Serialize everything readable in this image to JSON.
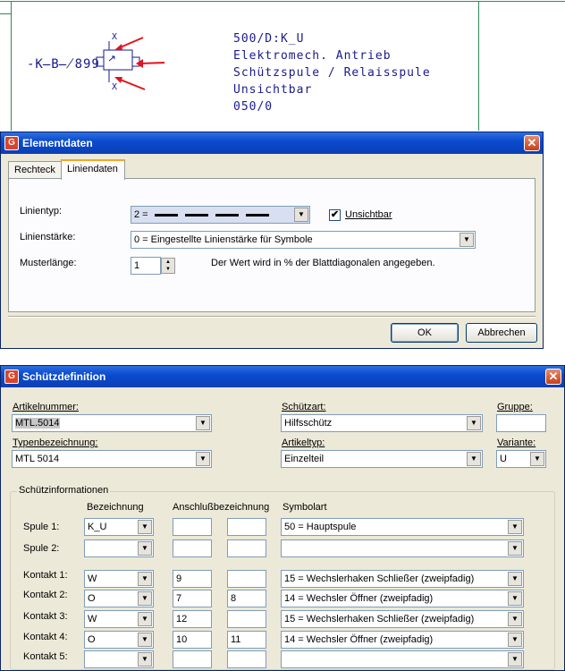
{
  "cad": {
    "designation": "-K̶B̶̸899",
    "info_lines": [
      "500/D:K_U",
      "Elektromech. Antrieb",
      "Schützspule / Relaisspule",
      "Unsichtbar",
      "050/0"
    ],
    "symbol_label": "X"
  },
  "elementdaten": {
    "title": "Elementdaten",
    "tabs": [
      "Rechteck",
      "Liniendaten"
    ],
    "linientyp_label": "Linientyp:",
    "linientyp_value": "2 =",
    "unsichtbar_label": "Unsichtbar",
    "unsichtbar_checked": "✔",
    "linienstaerke_label": "Linienstärke:",
    "linienstaerke_value": "0 = Eingestellte Linienstärke für Symbole",
    "musterlaenge_label": "Musterlänge:",
    "musterlaenge_value": "1",
    "musterlaenge_hint": "Der Wert wird in % der Blattdiagonalen angegeben.",
    "ok_label": "OK",
    "cancel_label": "Abbrechen"
  },
  "schuetz": {
    "title": "Schützdefinition",
    "artikelnummer_label": "Artikelnummer:",
    "artikelnummer_value": "MTL.5014",
    "schuetzart_label": "Schützart:",
    "schuetzart_value": "Hilfsschütz",
    "gruppe_label": "Gruppe:",
    "gruppe_value": "",
    "typenbezeichnung_label": "Typenbezeichnung:",
    "typenbezeichnung_value": "MTL 5014",
    "artikeltyp_label": "Artikeltyp:",
    "artikeltyp_value": "Einzelteil",
    "variante_label": "Variante:",
    "variante_value": "U",
    "group_label": "Schützinformationen",
    "col_bezeichnung": "Bezeichnung",
    "col_anschluss": "Anschlußbezeichnung",
    "col_symbolart": "Symbolart",
    "rows": [
      {
        "label": "Spule 1:",
        "bez": "K_U",
        "a1": "",
        "a2": "",
        "sym": "50 = Hauptspule"
      },
      {
        "label": "Spule 2:",
        "bez": "",
        "a1": "",
        "a2": "",
        "sym": ""
      },
      {
        "label": "Kontakt 1:",
        "bez": "W",
        "a1": "9",
        "a2": "",
        "sym": "15 = Wechslerhaken Schließer (zweipfadig)"
      },
      {
        "label": "Kontakt 2:",
        "bez": "O",
        "a1": "7",
        "a2": "8",
        "sym": "14 = Wechsler Öffner (zweipfadig)"
      },
      {
        "label": "Kontakt 3:",
        "bez": "W",
        "a1": "12",
        "a2": "",
        "sym": "15 = Wechslerhaken Schließer (zweipfadig)"
      },
      {
        "label": "Kontakt 4:",
        "bez": "O",
        "a1": "10",
        "a2": "11",
        "sym": "14 = Wechsler Öffner (zweipfadig)"
      },
      {
        "label": "Kontakt 5:",
        "bez": "",
        "a1": "",
        "a2": "",
        "sym": ""
      }
    ]
  },
  "colors": {
    "title_blue": "#0b4bd0",
    "cad_green": "#2e8b57",
    "cad_text": "#1a1a8c",
    "arrow_red": "#e0141e"
  },
  "icons": {
    "close": "close-icon",
    "app": "app-icon",
    "dropdown": "chevron-down-icon"
  }
}
